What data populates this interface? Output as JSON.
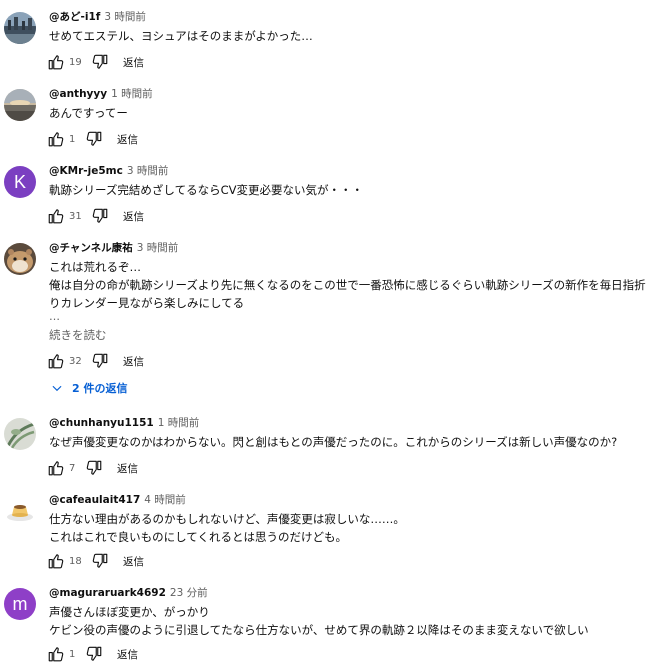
{
  "labels": {
    "reply": "返信",
    "read_more": "続きを読む",
    "ellipsis": "…"
  },
  "comments": [
    {
      "author": "@あど-i1f",
      "time": "3 時間前",
      "lines": [
        "せめてエステル、ヨシュアはそのままがよかった…"
      ],
      "likes": "19",
      "avatar": {
        "type": "photo",
        "icon": "landscape-avatar"
      }
    },
    {
      "author": "@anthyyy",
      "time": "1 時間前",
      "lines": [
        "あんですってー"
      ],
      "likes": "1",
      "avatar": {
        "type": "photo",
        "icon": "sunset-avatar"
      }
    },
    {
      "author": "@KMr-je5mc",
      "time": "3 時間前",
      "lines": [
        "軌跡シリーズ完結めざしてるならCV変更必要ない気が・・・"
      ],
      "likes": "31",
      "avatar": {
        "type": "letter",
        "letter": "K",
        "color": "#7b3fc1"
      }
    },
    {
      "author": "@チャンネル康祐",
      "time": "3 時間前",
      "lines": [
        "これは荒れるぞ…",
        "俺は自分の命が軌跡シリーズより先に無くなるのをこの世で一番恐怖に感じるぐらい軌跡シリーズの新作を毎日指折",
        "りカレンダー見ながら楽しみにしてる"
      ],
      "likes": "32",
      "avatar": {
        "type": "photo",
        "icon": "hamster-avatar"
      },
      "replies_label": "2 件の返信"
    },
    {
      "author": "@chunhanyu1151",
      "time": "1 時間前",
      "lines": [
        "なぜ声優変更なのかはわからない。閃と創はもとの声優だったのに。これからのシリーズは新しい声優なのか?"
      ],
      "likes": "7",
      "avatar": {
        "type": "photo",
        "icon": "plant-avatar"
      }
    },
    {
      "author": "@cafeaulait417",
      "time": "4 時間前",
      "lines": [
        "仕方ない理由があるのかもしれないけど、声優変更は寂しいな……。",
        "これはこれで良いものにしてくれるとは思うのだけども。"
      ],
      "likes": "18",
      "avatar": {
        "type": "photo",
        "icon": "pudding-avatar"
      }
    },
    {
      "author": "@maguraruark4692",
      "time": "23 分前",
      "lines": [
        "声優さんほぼ変更か、がっかり",
        "ケビン役の声優のように引退してたなら仕方ないが、せめて界の軌跡２以降はそのまま変えないで欲しい"
      ],
      "likes": "1",
      "avatar": {
        "type": "letter",
        "letter": "m",
        "color": "#8e3fc7"
      }
    }
  ]
}
